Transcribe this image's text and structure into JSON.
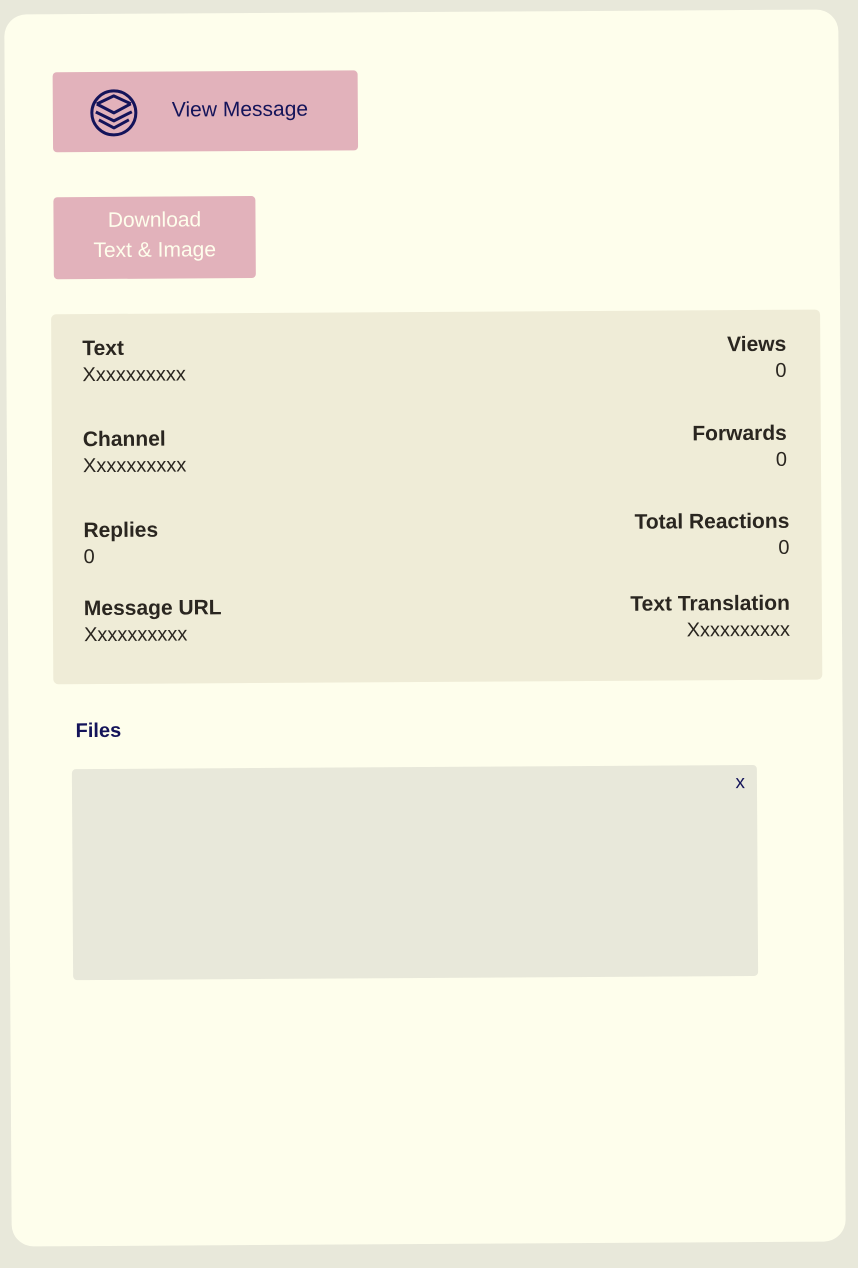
{
  "actions": {
    "view_message_label": "View Message",
    "download_line1": "Download",
    "download_line2": "Text & Image"
  },
  "info": {
    "text": {
      "label": "Text",
      "value": "Xxxxxxxxxx"
    },
    "views": {
      "label": "Views",
      "value": "0"
    },
    "channel": {
      "label": "Channel",
      "value": "Xxxxxxxxxx"
    },
    "forwards": {
      "label": "Forwards",
      "value": "0"
    },
    "replies": {
      "label": "Replies",
      "value": "0"
    },
    "total_reactions": {
      "label": "Total Reactions",
      "value": "0"
    },
    "message_url": {
      "label": "Message URL",
      "value": "Xxxxxxxxxx"
    },
    "text_translation": {
      "label": "Text Translation",
      "value": "Xxxxxxxxxx"
    }
  },
  "files": {
    "heading": "Files",
    "close_label": "x"
  },
  "icons": {
    "view_message": "layers-icon"
  },
  "colors": {
    "page_background": "#e8e8da",
    "card_background": "#fefeec",
    "button_background": "#e2b2bb",
    "panel_background": "#efecd7",
    "accent_text": "#14145a",
    "body_text": "#2a2620"
  }
}
